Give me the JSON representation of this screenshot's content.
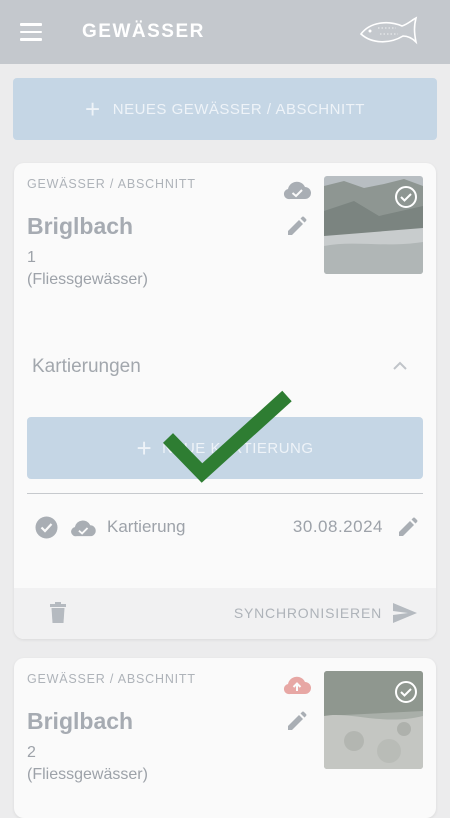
{
  "appbar": {
    "title": "GEWÄSSER"
  },
  "new_button": {
    "label": "NEUES GEWÄSSER / ABSCHNITT"
  },
  "cards": [
    {
      "eyebrow": "GEWÄSSER / ABSCHNITT",
      "title": "Briglbach",
      "number": "1",
      "type": "(Fliessgewässer)",
      "cloud_state": "synced",
      "kartierungen": {
        "header": "Kartierungen",
        "new_button_label": "NEUE KARTIERUNG",
        "rows": [
          {
            "label": "Kartierung",
            "date": "30.08.2024"
          }
        ]
      },
      "footer": {
        "sync_label": "SYNCHRONISIEREN"
      }
    },
    {
      "eyebrow": "GEWÄSSER / ABSCHNITT",
      "title": "Briglbach",
      "number": "2",
      "type": "(Fliessgewässer)",
      "cloud_state": "upload-pending"
    }
  ],
  "colors": {
    "appbar": "#c4c8cd",
    "button": "#c5d6e5",
    "success_check": "#2e7d32",
    "upload_cloud": "#e7a7a4"
  }
}
